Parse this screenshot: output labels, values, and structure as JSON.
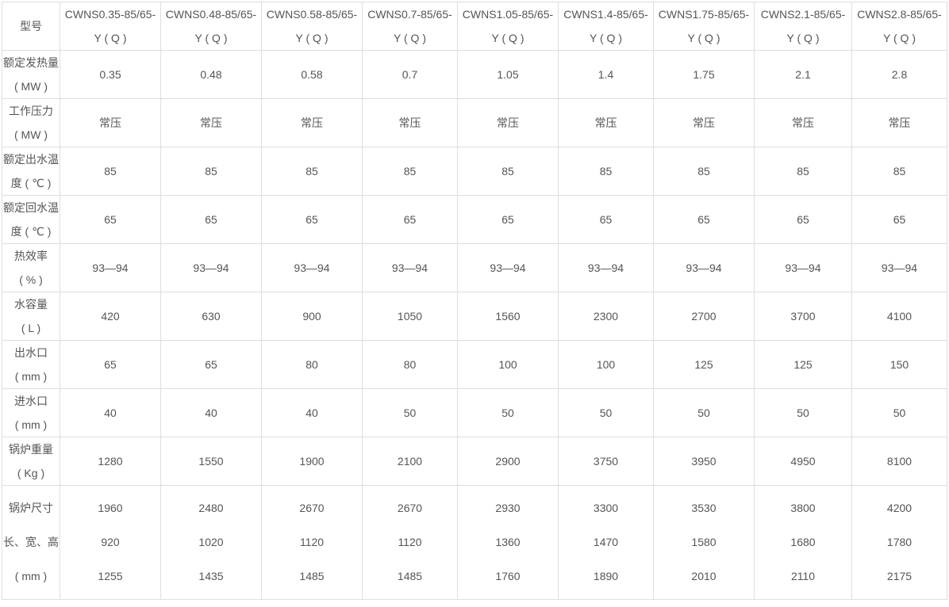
{
  "table": {
    "header_label": "型号",
    "models": [
      [
        "CWNS0.35-85/65-",
        "Y ( Q )"
      ],
      [
        "CWNS0.48-85/65-",
        "Y ( Q )"
      ],
      [
        "CWNS0.58-85/65-",
        "Y ( Q )"
      ],
      [
        "CWNS0.7-85/65-",
        "Y ( Q )"
      ],
      [
        "CWNS1.05-85/65-",
        "Y ( Q )"
      ],
      [
        "CWNS1.4-85/65-",
        "Y ( Q )"
      ],
      [
        "CWNS1.75-85/65-",
        "Y ( Q )"
      ],
      [
        "CWNS2.1-85/65-",
        "Y ( Q )"
      ],
      [
        "CWNS2.8-85/65-",
        "Y ( Q )"
      ]
    ],
    "rows": [
      {
        "label": [
          "额定发热量",
          "( MW )"
        ],
        "values": [
          "0.35",
          "0.48",
          "0.58",
          "0.7",
          "1.05",
          "1.4",
          "1.75",
          "2.1",
          "2.8"
        ]
      },
      {
        "label": [
          "工作压力",
          "( MW )"
        ],
        "values": [
          "常压",
          "常压",
          "常压",
          "常压",
          "常压",
          "常压",
          "常压",
          "常压",
          "常压"
        ]
      },
      {
        "label": [
          "额定出水温",
          "度 ( ℃ )"
        ],
        "values": [
          "85",
          "85",
          "85",
          "85",
          "85",
          "85",
          "85",
          "85",
          "85"
        ]
      },
      {
        "label": [
          "额定回水温",
          "度 ( ℃ )"
        ],
        "values": [
          "65",
          "65",
          "65",
          "65",
          "65",
          "65",
          "65",
          "65",
          "65"
        ]
      },
      {
        "label": [
          "热效率",
          "( % )"
        ],
        "values": [
          "93—94",
          "93—94",
          "93—94",
          "93—94",
          "93—94",
          "93—94",
          "93—94",
          "93—94",
          "93—94"
        ]
      },
      {
        "label": [
          "水容量",
          "( L )"
        ],
        "values": [
          "420",
          "630",
          "900",
          "1050",
          "1560",
          "2300",
          "2700",
          "3700",
          "4100"
        ]
      },
      {
        "label": [
          "出水口",
          "( mm )"
        ],
        "values": [
          "65",
          "65",
          "80",
          "80",
          "100",
          "100",
          "125",
          "125",
          "150"
        ]
      },
      {
        "label": [
          "进水口",
          "( mm )"
        ],
        "values": [
          "40",
          "40",
          "40",
          "50",
          "50",
          "50",
          "50",
          "50",
          "50"
        ]
      },
      {
        "label": [
          "锅炉重量",
          "( Kg )"
        ],
        "values": [
          "1280",
          "1550",
          "1900",
          "2100",
          "2900",
          "3750",
          "3950",
          "4950",
          "8100"
        ]
      }
    ],
    "size_row": {
      "label": [
        "锅炉尺寸",
        "长、宽、高",
        "( mm )"
      ],
      "values": [
        [
          "1960",
          "920",
          "1255"
        ],
        [
          "2480",
          "1020",
          "1435"
        ],
        [
          "2670",
          "1120",
          "1485"
        ],
        [
          "2670",
          "1120",
          "1485"
        ],
        [
          "2930",
          "1360",
          "1760"
        ],
        [
          "3300",
          "1470",
          "1890"
        ],
        [
          "3530",
          "1580",
          "2010"
        ],
        [
          "3800",
          "1680",
          "2110"
        ],
        [
          "4200",
          "1780",
          "2175"
        ]
      ]
    }
  }
}
